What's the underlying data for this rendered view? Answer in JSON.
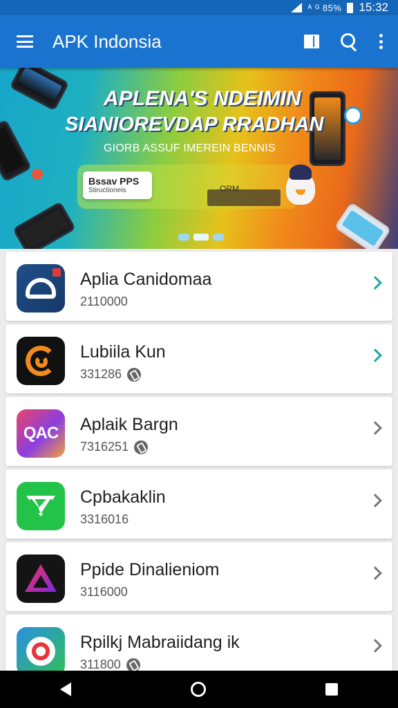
{
  "status_bar": {
    "text": "ᴬ ᴳ 85%",
    "time": "15:32"
  },
  "appbar": {
    "title": "APK Indonsia"
  },
  "banner": {
    "line1": "APLENA'S NDEIMIN",
    "line2": "SIANIOREVDAP RRADHAN",
    "line3": "GIORB ASSUF IMEREIN BENNIS",
    "card_title": "Bssav PPS",
    "card_sub": "Stiructioneis",
    "small_label": "ORM",
    "slide_count": 3,
    "active_slide": 2
  },
  "apps": [
    {
      "name": "Aplia Canidomaa",
      "meta": "2110000",
      "meta_icon": false,
      "icon": "cloud-icon",
      "chevron": "teal"
    },
    {
      "name": "Lubiila Kun",
      "meta": "331286",
      "meta_icon": true,
      "icon": "spiral-g-icon",
      "chevron": "teal"
    },
    {
      "name": "Aplaik Bargn",
      "meta": "7316251",
      "meta_icon": true,
      "icon": "qac-icon",
      "chevron": "gray"
    },
    {
      "name": "Cpbakaklin",
      "meta": "3316016",
      "meta_icon": false,
      "icon": "diamond-check-icon",
      "chevron": "gray"
    },
    {
      "name": "Ppide Dinalieniom",
      "meta": "3116000",
      "meta_icon": false,
      "icon": "triangle-icon",
      "chevron": "gray"
    },
    {
      "name": "Rpilkj Mabraiidang ik",
      "meta": "311800",
      "meta_icon": true,
      "icon": "ring-icon",
      "chevron": "gray"
    }
  ],
  "colors": {
    "appbar": "#1a74cf",
    "status_bar": "#1466b8",
    "chevron_teal": "#1aa7a0",
    "background": "#ececec"
  }
}
